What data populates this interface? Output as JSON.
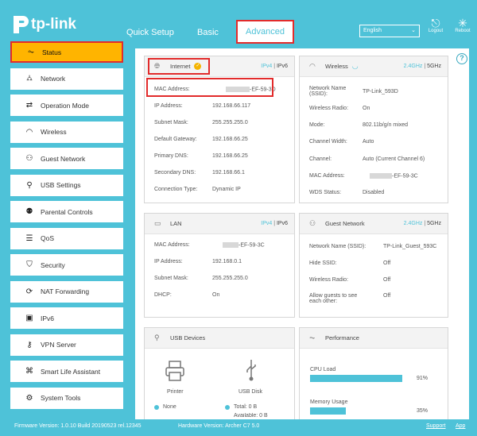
{
  "app": {
    "brand": "tp-link"
  },
  "nav": {
    "tabs": [
      "Quick Setup",
      "Basic",
      "Advanced"
    ],
    "active": "Advanced"
  },
  "language": {
    "value": "English"
  },
  "top_actions": [
    {
      "label": "Logout",
      "icon": "logout-icon"
    },
    {
      "label": "Reboot",
      "icon": "reboot-icon"
    }
  ],
  "sidebar": {
    "items": [
      {
        "label": "Status",
        "icon": "pulse-icon"
      },
      {
        "label": "Network",
        "icon": "network-icon"
      },
      {
        "label": "Operation Mode",
        "icon": "operation-mode-icon"
      },
      {
        "label": "Wireless",
        "icon": "wifi-icon"
      },
      {
        "label": "Guest Network",
        "icon": "guest-icon"
      },
      {
        "label": "USB Settings",
        "icon": "usb-icon"
      },
      {
        "label": "Parental Controls",
        "icon": "parental-icon"
      },
      {
        "label": "QoS",
        "icon": "qos-icon"
      },
      {
        "label": "Security",
        "icon": "shield-icon"
      },
      {
        "label": "NAT Forwarding",
        "icon": "nat-icon"
      },
      {
        "label": "IPv6",
        "icon": "ipv6-icon"
      },
      {
        "label": "VPN Server",
        "icon": "vpn-icon"
      },
      {
        "label": "Smart Life Assistant",
        "icon": "smart-life-icon"
      },
      {
        "label": "System Tools",
        "icon": "gear-icon"
      }
    ]
  },
  "internet": {
    "title": "Internet",
    "ipv4": "IPv4",
    "ipv6": "IPv6",
    "mac_label": "MAC Address:",
    "mac_value": "-EF-59-3D",
    "ip_label": "IP Address:",
    "ip_value": "192.168.66.117",
    "subnet_label": "Subnet Mask:",
    "subnet_value": "255.255.255.0",
    "gateway_label": "Default Gateway:",
    "gateway_value": "192.168.66.25",
    "pdns_label": "Primary DNS:",
    "pdns_value": "192.168.66.25",
    "sdns_label": "Secondary DNS:",
    "sdns_value": "192.168.66.1",
    "conn_label": "Connection Type:",
    "conn_value": "Dynamic IP"
  },
  "wireless": {
    "title": "Wireless",
    "band24": "2.4GHz",
    "band5": "5GHz",
    "name_label": "Network Name (SSID):",
    "name_value": "TP-Link_593D",
    "radio_label": "Wireless Radio:",
    "radio_value": "On",
    "mode_label": "Mode:",
    "mode_value": "802.11b/g/n mixed",
    "width_label": "Channel Width:",
    "width_value": "Auto",
    "channel_label": "Channel:",
    "channel_value": "Auto (Current Channel 6)",
    "mac_label": "MAC Address:",
    "mac_value": "-EF-59-3C",
    "wds_label": "WDS Status:",
    "wds_value": "Disabled"
  },
  "lan": {
    "title": "LAN",
    "ipv4": "IPv4",
    "ipv6": "IPv6",
    "mac_label": "MAC Address:",
    "mac_value": "-EF-59-3C",
    "ip_label": "IP Address:",
    "ip_value": "192.168.0.1",
    "subnet_label": "Subnet Mask:",
    "subnet_value": "255.255.255.0",
    "dhcp_label": "DHCP:",
    "dhcp_value": "On"
  },
  "guest": {
    "title": "Guest Network",
    "band24": "2.4GHz",
    "band5": "5GHz",
    "name_label": "Network Name (SSID):",
    "name_value": "TP-Link_Guest_593C",
    "hide_label": "Hide SSID:",
    "hide_value": "Off",
    "radio_label": "Wireless Radio:",
    "radio_value": "Off",
    "allow_label": "Allow guests to see each other:",
    "allow_value": "Off"
  },
  "usb": {
    "title": "USB Devices",
    "printer_label": "Printer",
    "printer_status": "None",
    "disk_label": "USB Disk",
    "disk_total": "Total: 0 B",
    "disk_avail": "Available: 0 B"
  },
  "performance": {
    "title": "Performance",
    "cpu_label": "CPU Load",
    "cpu_value": "91%",
    "cpu_fraction": 0.91,
    "mem_label": "Memory Usage",
    "mem_value": "35%",
    "mem_fraction": 0.35
  },
  "footer": {
    "firmware": "Firmware Version: 1.0.10 Build 20190523 rel.12345",
    "hardware": "Hardware Version: Archer C7 5.0",
    "support": "Support",
    "app": "App"
  },
  "colors": {
    "accent": "#4ec2d8",
    "highlight": "#ffb400",
    "annotation": "#e22b2b"
  }
}
